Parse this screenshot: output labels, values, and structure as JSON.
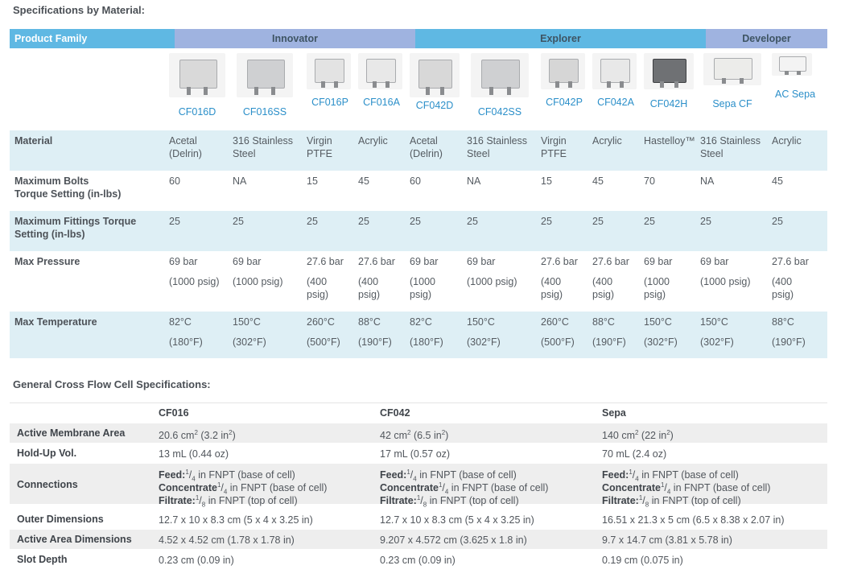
{
  "headings": {
    "specs_by_material": "Specifications by Material:",
    "general_specs": "General Cross Flow Cell Specifications:"
  },
  "table1": {
    "family_label": "Product Family",
    "families": [
      "Innovator",
      "Explorer",
      "Developer"
    ],
    "colors": {
      "header_dark": "#5fb8e3",
      "header_light": "#9fb3e0",
      "row_band": "#deeff5",
      "link": "#2b8fc9"
    },
    "products": [
      {
        "name": "CF016D",
        "material_1": "Acetal",
        "material_2": "(Delrin)",
        "bolts": "60",
        "fittings": "25",
        "pressure_1": "69 bar",
        "pressure_2": "(1000 psig)",
        "pressure_3": "",
        "temp_1": "82°C",
        "temp_2": "(180°F)"
      },
      {
        "name": "CF016SS",
        "material_1": "316 Stainless",
        "material_2": "Steel",
        "bolts": "NA",
        "fittings": "25",
        "pressure_1": "69 bar",
        "pressure_2": "(1000 psig)",
        "pressure_3": "",
        "temp_1": "150°C",
        "temp_2": "(302°F)"
      },
      {
        "name": "CF016P",
        "material_1": "Virgin",
        "material_2": "PTFE",
        "bolts": "15",
        "fittings": "25",
        "pressure_1": "27.6 bar",
        "pressure_2": "(400",
        "pressure_3": "psig)",
        "temp_1": "260°C",
        "temp_2": "(500°F)"
      },
      {
        "name": "CF016A",
        "material_1": "Acrylic",
        "material_2": "",
        "bolts": "45",
        "fittings": "25",
        "pressure_1": "27.6 bar",
        "pressure_2": "(400",
        "pressure_3": "psig)",
        "temp_1": "88°C",
        "temp_2": "(190°F)"
      },
      {
        "name": "CF042D",
        "material_1": "Acetal",
        "material_2": "(Delrin)",
        "bolts": "60",
        "fittings": "25",
        "pressure_1": "69 bar",
        "pressure_2": "(1000",
        "pressure_3": "psig)",
        "temp_1": "82°C",
        "temp_2": "(180°F)"
      },
      {
        "name": "CF042SS",
        "material_1": "316 Stainless",
        "material_2": "Steel",
        "bolts": "NA",
        "fittings": "25",
        "pressure_1": "69 bar",
        "pressure_2": "(1000 psig)",
        "pressure_3": "",
        "temp_1": "150°C",
        "temp_2": "(302°F)"
      },
      {
        "name": "CF042P",
        "material_1": "Virgin",
        "material_2": "PTFE",
        "bolts": "15",
        "fittings": "25",
        "pressure_1": "27.6 bar",
        "pressure_2": "(400",
        "pressure_3": "psig)",
        "temp_1": "260°C",
        "temp_2": "(500°F)"
      },
      {
        "name": "CF042A",
        "material_1": "Acrylic",
        "material_2": "",
        "bolts": "45",
        "fittings": "25",
        "pressure_1": "27.6 bar",
        "pressure_2": "(400",
        "pressure_3": "psig)",
        "temp_1": "88°C",
        "temp_2": "(190°F)"
      },
      {
        "name": "CF042H",
        "material_1": "Hastelloy™",
        "material_2": "",
        "bolts": "70",
        "fittings": "25",
        "pressure_1": "69 bar",
        "pressure_2": "(1000",
        "pressure_3": "psig)",
        "temp_1": "150°C",
        "temp_2": "(302°F)"
      },
      {
        "name": "Sepa CF",
        "material_1": "316 Stainless",
        "material_2": "Steel",
        "bolts": "NA",
        "fittings": "25",
        "pressure_1": "69 bar",
        "pressure_2": "(1000 psig)",
        "pressure_3": "",
        "temp_1": "150°C",
        "temp_2": "(302°F)"
      },
      {
        "name": "AC Sepa",
        "material_1": "Acrylic",
        "material_2": "",
        "bolts": "45",
        "fittings": "25",
        "pressure_1": "27.6 bar",
        "pressure_2": "(400",
        "pressure_3": "psig)",
        "temp_1": "88°C",
        "temp_2": "(190°F)"
      }
    ],
    "row_labels": {
      "material": "Material",
      "bolts_1": "Maximum Bolts",
      "bolts_2": "Torque Setting (in-lbs)",
      "fittings_1": "Maximum Fittings Torque",
      "fittings_2": "Setting (in-lbs)",
      "pressure": "Max Pressure",
      "temperature": "Max Temperature"
    }
  },
  "table2": {
    "columns": [
      "CF016",
      "CF042",
      "Sepa"
    ],
    "rows": {
      "area": {
        "label": "Active Membrane Area",
        "values": [
          [
            "20.6 cm",
            "2",
            " (3.2 in",
            "2",
            ")"
          ],
          [
            "42 cm",
            "2",
            " (6.5 in",
            "2",
            ")"
          ],
          [
            "140 cm",
            "2",
            " (22 in",
            "2",
            ")"
          ]
        ]
      },
      "holdup": {
        "label": "Hold-Up Vol.",
        "values": [
          "13 mL (0.44 oz)",
          "17 mL (0.57 oz)",
          "70 mL (2.4 oz)"
        ]
      },
      "connections": {
        "label": "Connections",
        "feed_label": "Feed:",
        "feed_frac_num": "1",
        "feed_frac_den": "4",
        "feed_text": " in FNPT (base of cell)",
        "conc_label": "Concentrate",
        "conc_frac_num": "1",
        "conc_frac_den": "4",
        "conc_text": " in FNPT (base of cell)",
        "filt_label": "Filtrate:",
        "filt_frac_num": "1",
        "filt_frac_den": "8",
        "filt_text": " in FNPT (top of cell)"
      },
      "outer": {
        "label": "Outer Dimensions",
        "values": [
          "12.7 x 10 x 8.3 cm (5 x 4 x 3.25 in)",
          "12.7 x 10 x 8.3 cm (5 x 4 x 3.25 in)",
          "16.51 x 21.3 x 5 cm (6.5 x 8.38 x 2.07 in)"
        ]
      },
      "active_dim": {
        "label": "Active Area Dimensions",
        "values": [
          "4.52 x 4.52 cm (1.78 x 1.78 in)",
          "9.207 x 4.572 cm (3.625 x 1.8 in)",
          "9.7 x 14.7 cm (3.81 x 5.78 in)"
        ]
      },
      "slot": {
        "label": "Slot Depth",
        "values": [
          "0.23 cm (0.09 in)",
          "0.23 cm (0.09 in)",
          "0.19 cm (0.075 in)"
        ]
      }
    }
  }
}
